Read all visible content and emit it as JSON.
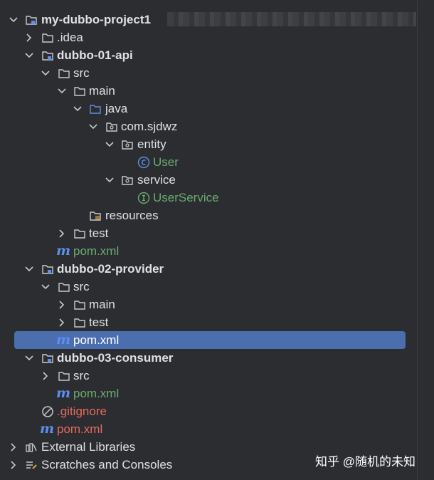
{
  "project": {
    "root_label": "my-dubbo-project1",
    "idea_folder": ".idea",
    "module_api": "dubbo-01-api",
    "src": "src",
    "main": "main",
    "java": "java",
    "package": "com.sjdwz",
    "entity": "entity",
    "user_class": "User",
    "service_pkg": "service",
    "user_service": "UserService",
    "resources": "resources",
    "test": "test",
    "pom": "pom.xml",
    "module_provider": "dubbo-02-provider",
    "module_consumer": "dubbo-03-consumer",
    "gitignore": ".gitignore",
    "external_libraries": "External Libraries",
    "scratches": "Scratches and Consoles"
  },
  "watermark": "知乎 @随机的未知",
  "colors": {
    "background": "#2b2d30",
    "selection": "#4a6eae",
    "text": "#dfe1e5",
    "green_file": "#6aab73",
    "red_file": "#e86a5f",
    "maven_icon": "#5d8ff0"
  },
  "icons": [
    "chevron-down-icon",
    "chevron-right-icon",
    "module-icon",
    "folder-icon",
    "source-folder-icon",
    "package-icon",
    "resources-folder-icon",
    "class-icon",
    "interface-icon",
    "maven-icon",
    "ignore-icon",
    "library-icon",
    "scratches-icon"
  ]
}
